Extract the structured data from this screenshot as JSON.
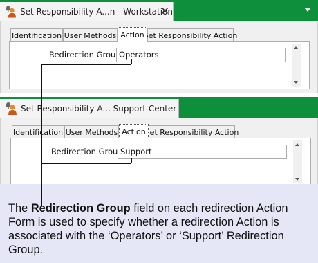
{
  "panels": [
    {
      "window_title": "Set Responsibility A...n - Workstation",
      "close_glyph": "✕",
      "tabs": [
        "Identification",
        "User Methods",
        "Action",
        "Set Responsibility Action"
      ],
      "active_tab": "Action",
      "field_label": "Redirection Group",
      "field_value": "Operators"
    },
    {
      "window_title": "Set Responsibility A... Support Center",
      "tabs": [
        "Identification",
        "User Methods",
        "Action",
        "Set Responsibility Action"
      ],
      "active_tab": "Action",
      "field_label": "Redirection Group",
      "field_value": "Support"
    }
  ],
  "callout": {
    "before": "The ",
    "bold": "Redirection Group",
    "after": " field on each redirection Action Form is used to specify whether a redirection Action is associated with the ‘Operators’ or ‘Support’ Redirection Group."
  },
  "colors": {
    "title_bar_green": "#0e8f3c",
    "callout_background": "#e5e6f6",
    "icon": "person-bell-icon"
  }
}
